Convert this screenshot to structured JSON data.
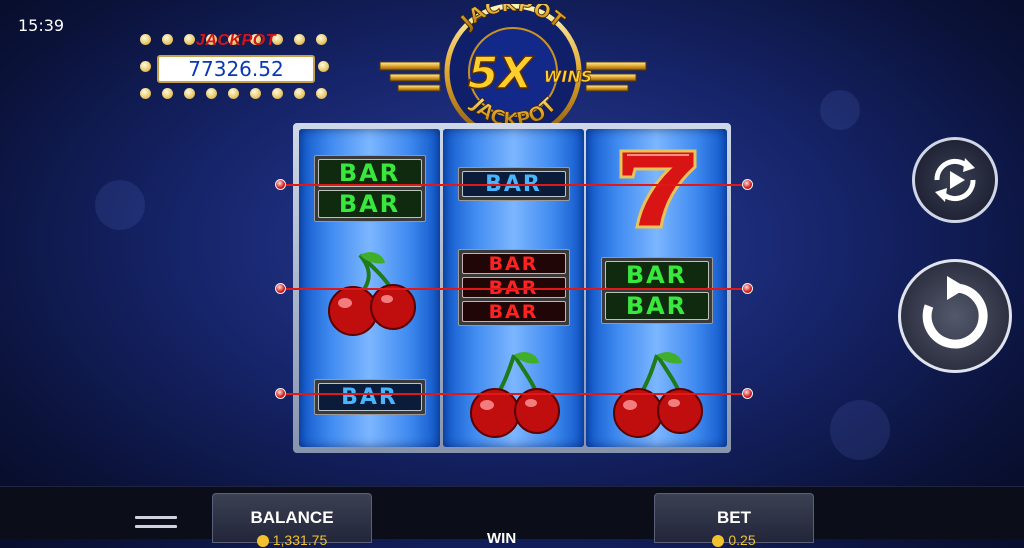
{
  "status": {
    "time": "15:39"
  },
  "session_id": "6276351663",
  "jackpot": {
    "label": "JACKPOT",
    "amount": "77326.52"
  },
  "logo": {
    "top_text": "JACKPOT",
    "center_text": "5X",
    "wins_text": "WINS",
    "bottom_text": "JACKPOT"
  },
  "reels": [
    {
      "symbols": [
        "double-bar-green",
        "cherry",
        "bar-blue"
      ]
    },
    {
      "symbols": [
        "bar-blue",
        "triple-bar-red",
        "cherry"
      ]
    },
    {
      "symbols": [
        "seven-red",
        "double-bar-green",
        "cherry"
      ]
    }
  ],
  "symbol_text": {
    "bar": "BAR"
  },
  "paylines": 3,
  "controls": {
    "autoplay_icon": "autoplay-icon",
    "spin_icon": "spin-icon",
    "menu_icon": "hamburger-menu-icon"
  },
  "footer": {
    "balance_label": "BALANCE",
    "balance_value": "1,331.75",
    "win_label": "WIN",
    "bet_label": "BET",
    "bet_value": "0.25"
  },
  "colors": {
    "payline": "#e01818",
    "reel_blue": "#3f8af0",
    "accent_gold": "#f2c12e"
  }
}
